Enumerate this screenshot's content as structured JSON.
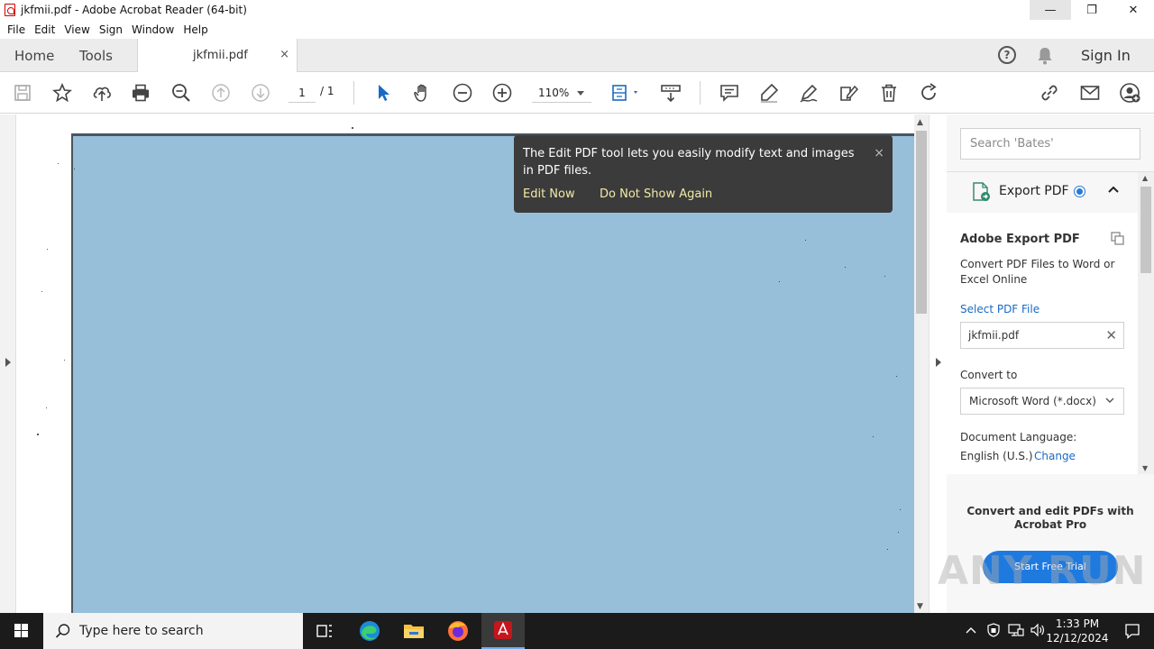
{
  "window": {
    "title": "jkfmii.pdf - Adobe Acrobat Reader (64-bit)",
    "min_glyph": "—",
    "max_glyph": "❐",
    "close_glyph": "✕"
  },
  "menu": [
    "File",
    "Edit",
    "View",
    "Sign",
    "Window",
    "Help"
  ],
  "tabs": {
    "home": "Home",
    "tools": "Tools",
    "doc": "jkfmii.pdf",
    "doc_close": "×",
    "help": "?",
    "sign_in": "Sign In"
  },
  "toolbar": {
    "page_current": "1",
    "page_total": "/ 1",
    "zoom": "110%"
  },
  "tooltip": {
    "text": "The Edit PDF tool lets you easily modify text and images in PDF files.",
    "close": "×",
    "edit_now": "Edit Now",
    "do_not_show": "Do Not Show Again"
  },
  "right_panel": {
    "search_placeholder": "Search 'Bates'",
    "export_label": "Export PDF",
    "export_title": "Adobe Export PDF",
    "export_desc": "Convert PDF Files to Word or Excel Online",
    "select_file": "Select PDF File",
    "file_name": "jkfmii.pdf",
    "convert_to": "Convert to",
    "format": "Microsoft Word (*.docx)",
    "doc_language": "Document Language:",
    "language": "English (U.S.)",
    "change": "Change",
    "promo": "Convert and edit PDFs with Acrobat Pro",
    "trial": "Start Free Trial"
  },
  "watermark": "ANY RUN",
  "taskbar": {
    "search_placeholder": "Type here to search",
    "time": "1:33 PM",
    "date": "12/12/2024"
  },
  "colors": {
    "page_fill": "#97bfd9",
    "tooltip_bg": "#3b3b3b",
    "link": "#1a6ac4",
    "accent": "#1f7ae0"
  }
}
